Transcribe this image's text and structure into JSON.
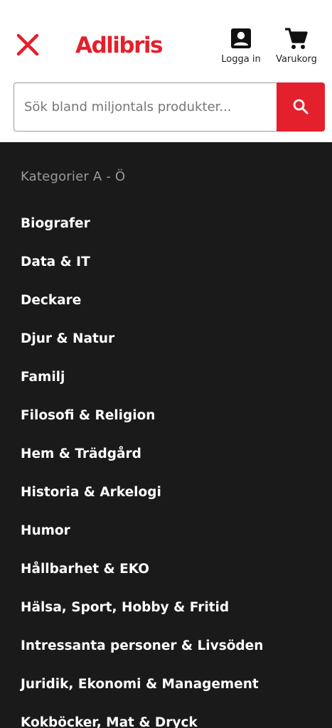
{
  "header": {
    "logo_text": "Adlibris",
    "login_label": "Logga in",
    "cart_label": "Varukorg",
    "brand_color": "#e4202c"
  },
  "search": {
    "placeholder": "Sök bland miljontals produkter...",
    "value": ""
  },
  "menu": {
    "heading": "Kategorier A - Ö",
    "items": [
      "Biografer",
      "Data & IT",
      "Deckare",
      "Djur & Natur",
      "Familj",
      "Filosofi & Religion",
      "Hem & Trädgård",
      "Historia & Arkelogi",
      "Humor",
      "Hållbarhet & EKO",
      "Hälsa, Sport, Hobby & Fritid",
      "Intressanta personer & Livsöden",
      "Juridik, Ekonomi & Management",
      "Kokböcker, Mat & Dryck"
    ]
  },
  "icons": {
    "close": "close-icon",
    "login": "user-icon",
    "cart": "cart-icon",
    "search": "search-icon"
  }
}
